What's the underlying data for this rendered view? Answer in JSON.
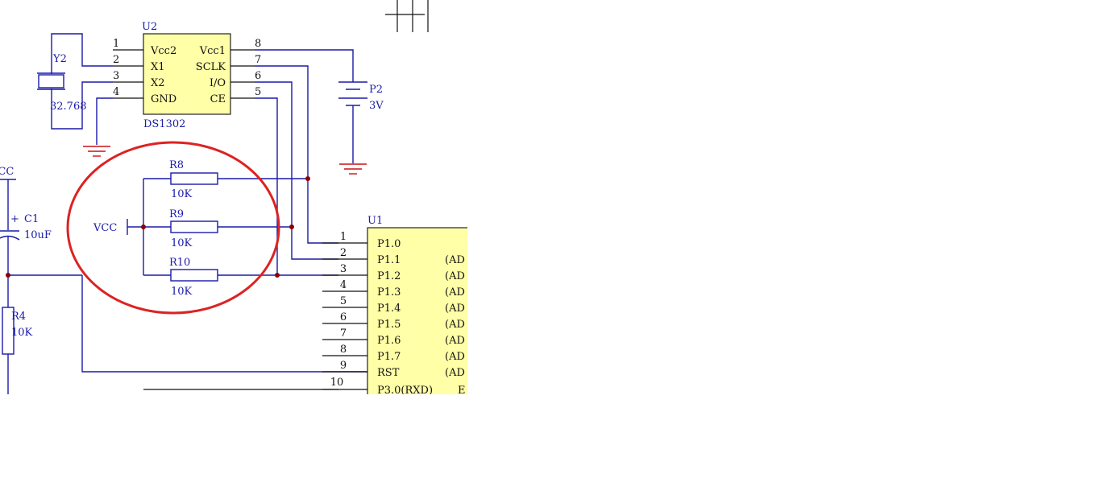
{
  "u2": {
    "ref": "U2",
    "part": "DS1302",
    "left_pins": [
      {
        "num": "1",
        "name": "Vcc2"
      },
      {
        "num": "2",
        "name": "X1"
      },
      {
        "num": "3",
        "name": "X2"
      },
      {
        "num": "4",
        "name": "GND"
      }
    ],
    "right_pins": [
      {
        "num": "8",
        "name": "Vcc1"
      },
      {
        "num": "7",
        "name": "SCLK"
      },
      {
        "num": "6",
        "name": "I/O"
      },
      {
        "num": "5",
        "name": "CE"
      }
    ]
  },
  "crystal": {
    "ref": "Y2",
    "value": "32.768"
  },
  "battery": {
    "ref": "P2",
    "value": "3V"
  },
  "resistors": {
    "r8": {
      "ref": "R8",
      "value": "10K"
    },
    "r9": {
      "ref": "R9",
      "value": "10K"
    },
    "r10": {
      "ref": "R10",
      "value": "10K"
    },
    "r4": {
      "ref": "R4",
      "value": "10K"
    }
  },
  "capacitor": {
    "ref": "C1",
    "value": "10uF",
    "polarity": "+"
  },
  "vcc": {
    "left_label": "VCC",
    "pullup_label": "VCC"
  },
  "u1": {
    "ref": "U1",
    "pins": [
      {
        "num": "1",
        "name": "P1.0",
        "alt": ""
      },
      {
        "num": "2",
        "name": "P1.1",
        "alt": "(AD"
      },
      {
        "num": "3",
        "name": "P1.2",
        "alt": "(AD"
      },
      {
        "num": "4",
        "name": "P1.3",
        "alt": "(AD"
      },
      {
        "num": "5",
        "name": "P1.4",
        "alt": "(AD"
      },
      {
        "num": "6",
        "name": "P1.5",
        "alt": "(AD"
      },
      {
        "num": "7",
        "name": "P1.6",
        "alt": "(AD"
      },
      {
        "num": "8",
        "name": "P1.7",
        "alt": "(AD"
      },
      {
        "num": "9",
        "name": "RST",
        "alt": "(AD"
      },
      {
        "num": "10",
        "name": "P3.0(RXD)",
        "alt": "E"
      }
    ]
  },
  "colors": {
    "wire": "#1a1aa8",
    "highlight": "#dd2222",
    "ground": "#cc1111",
    "chip_fill": "#ffffa8",
    "junction": "#8b0000"
  }
}
